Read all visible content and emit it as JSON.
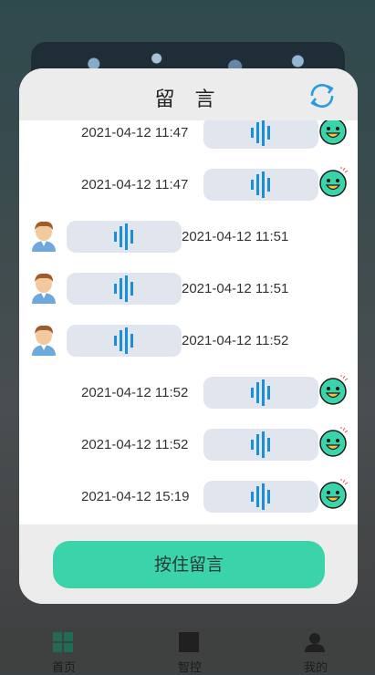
{
  "dialog": {
    "title": "留 言",
    "hold_button_label": "按住留言"
  },
  "messages": [
    {
      "side": "right",
      "timestamp": "2021-04-12 11:47",
      "avatar": "smiley-face-icon"
    },
    {
      "side": "right",
      "timestamp": "2021-04-12 11:47",
      "avatar": "smiley-face-icon"
    },
    {
      "side": "left",
      "timestamp": "2021-04-12 11:51",
      "avatar": "man-avatar-icon"
    },
    {
      "side": "left",
      "timestamp": "2021-04-12 11:51",
      "avatar": "man-avatar-icon"
    },
    {
      "side": "left",
      "timestamp": "2021-04-12 11:52",
      "avatar": "man-avatar-icon"
    },
    {
      "side": "right",
      "timestamp": "2021-04-12 11:52",
      "avatar": "smiley-face-icon"
    },
    {
      "side": "right",
      "timestamp": "2021-04-12 11:52",
      "avatar": "smiley-face-icon"
    },
    {
      "side": "right",
      "timestamp": "2021-04-12 15:19",
      "avatar": "smiley-face-icon"
    }
  ],
  "tabbar": {
    "tabs": [
      {
        "label": "首页",
        "icon": "grid-icon"
      },
      {
        "label": "智控",
        "icon": "square-icon"
      },
      {
        "label": "我的",
        "icon": "person-icon"
      }
    ]
  },
  "colors": {
    "accent_green": "#3bd4aa",
    "bubble": "#e1e5ee",
    "waveform_blue": "#1a8fd6",
    "refresh_blue": "#2a9be0"
  }
}
